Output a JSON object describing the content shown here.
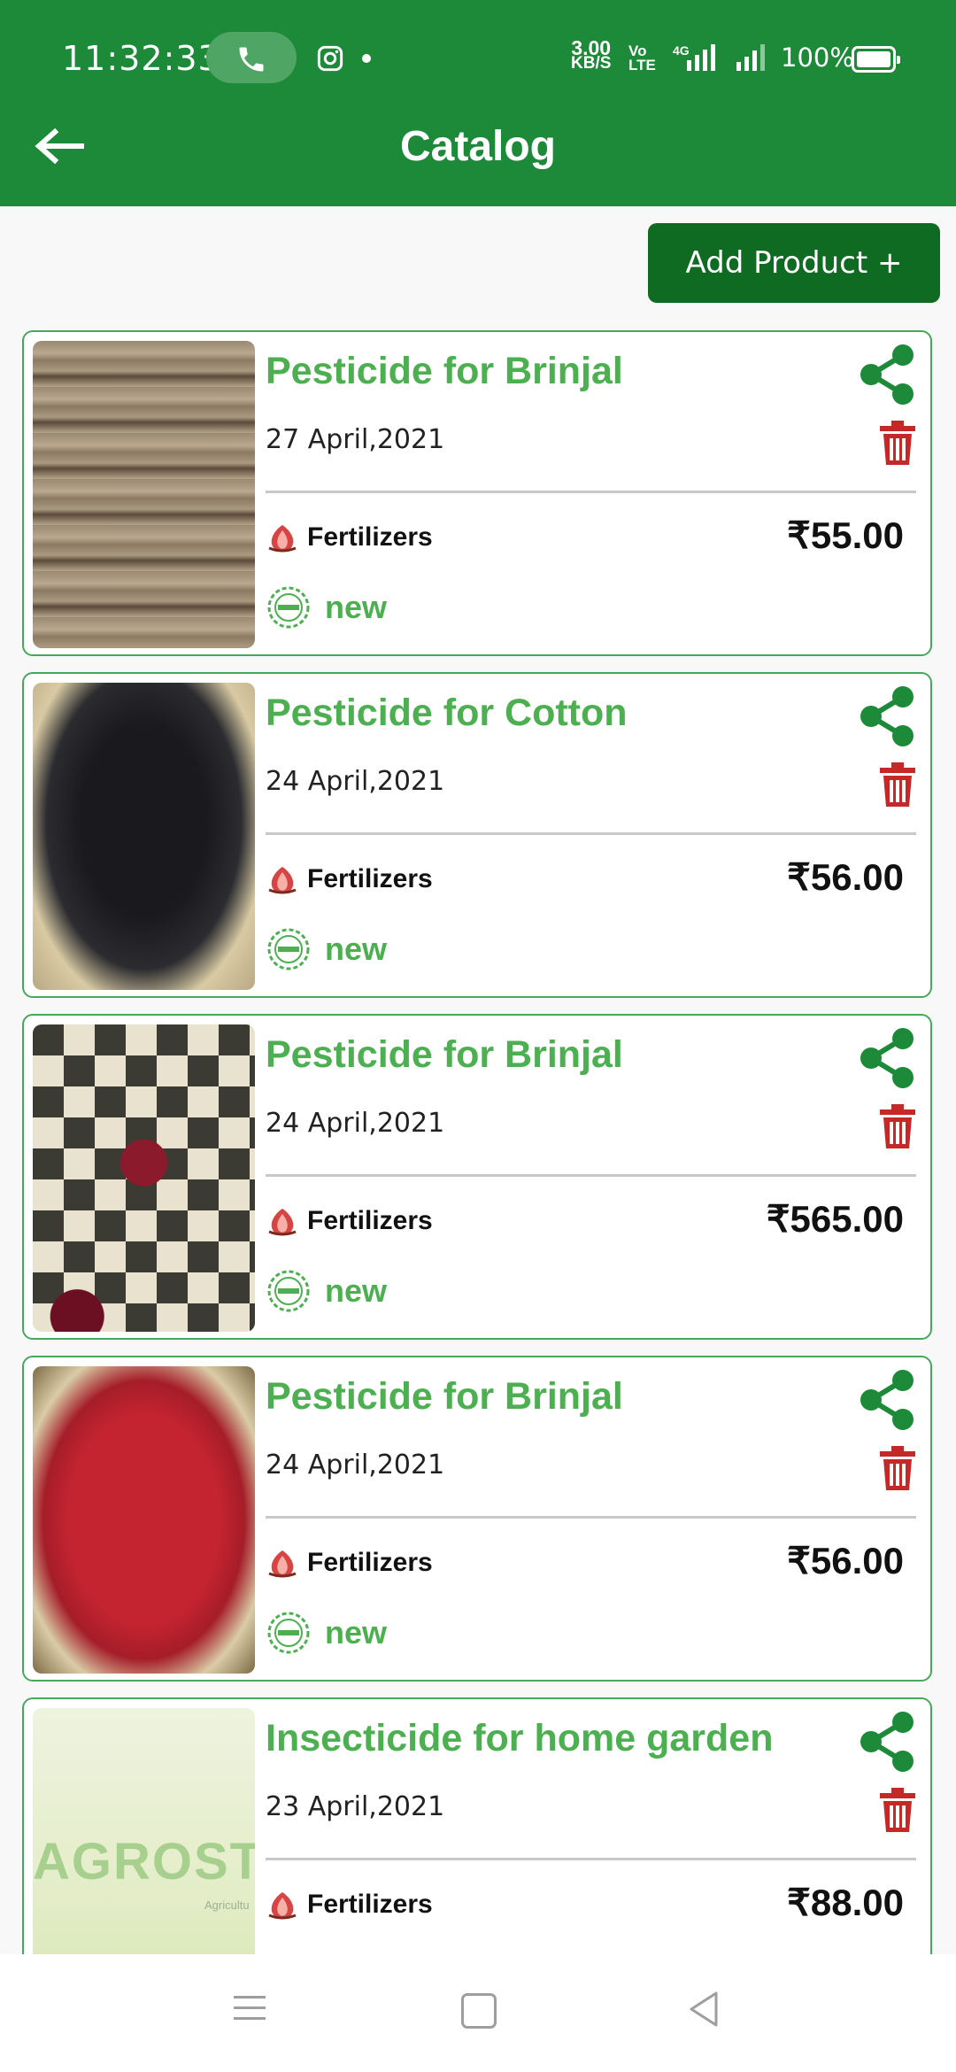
{
  "status_bar": {
    "time": "11:32:33",
    "net_speed_value": "3.00",
    "net_speed_unit": "KB/S",
    "volte_top": "Vo",
    "volte_bottom": "LTE",
    "network": "4G",
    "battery": "100%"
  },
  "app_bar": {
    "title": "Catalog"
  },
  "toolbar": {
    "add_product_label": "Add Product +"
  },
  "products": [
    {
      "title": "Pesticide for Brinjal",
      "date": "27 April,2021",
      "category": "Fertilizers",
      "price": "₹55.00",
      "condition": "new"
    },
    {
      "title": "Pesticide for Cotton",
      "date": "24 April,2021",
      "category": "Fertilizers",
      "price": "₹56.00",
      "condition": "new"
    },
    {
      "title": "Pesticide for Brinjal",
      "date": "24 April,2021",
      "category": "Fertilizers",
      "price": "₹565.00",
      "condition": "new"
    },
    {
      "title": "Pesticide for Brinjal",
      "date": "24 April,2021",
      "category": "Fertilizers",
      "price": "₹56.00",
      "condition": "new"
    },
    {
      "title": "Insecticide for home garden",
      "date": "23 April,2021",
      "category": "Fertilizers",
      "price": "₹88.00",
      "thumb_watermark": "AGROSTA",
      "thumb_watermark_sub": "Agricultu"
    }
  ],
  "colors": {
    "app_bar": "#1c8a38",
    "add_button": "#0f6b22",
    "accent_green": "#4caf50",
    "delete_red": "#c62828"
  }
}
